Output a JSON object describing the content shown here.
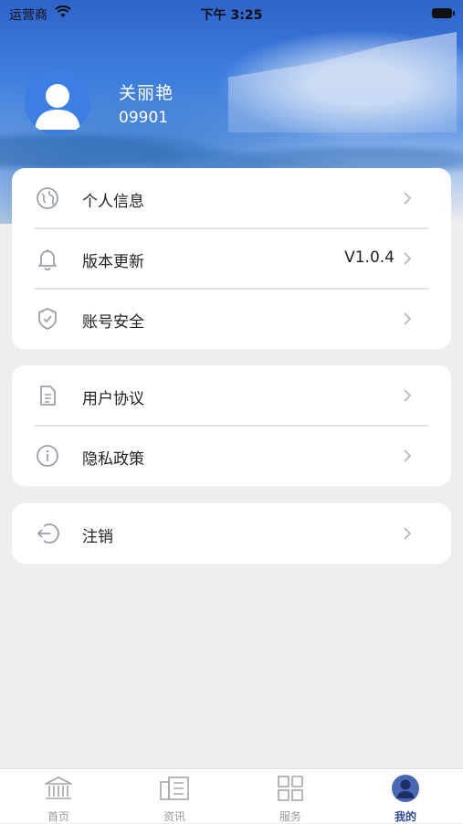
{
  "status_bar": {
    "carrier": "运营商",
    "time": "下午 3:25"
  },
  "profile": {
    "name": "关丽艳",
    "id": "09901"
  },
  "groups": [
    {
      "items": [
        {
          "label": "个人信息",
          "icon": "globe-icon"
        },
        {
          "label": "版本更新",
          "value": "V1.0.4",
          "icon": "bell-icon"
        },
        {
          "label": "账号安全",
          "icon": "shield-icon"
        }
      ]
    },
    {
      "items": [
        {
          "label": "用户协议",
          "icon": "document-icon"
        },
        {
          "label": "隐私政策",
          "icon": "info-icon"
        }
      ]
    },
    {
      "items": [
        {
          "label": "注销",
          "icon": "logout-icon"
        }
      ]
    }
  ],
  "tabs": [
    {
      "label": "首页",
      "icon": "home-icon"
    },
    {
      "label": "资讯",
      "icon": "news-icon"
    },
    {
      "label": "服务",
      "icon": "grid-icon"
    },
    {
      "label": "我的",
      "icon": "profile-icon",
      "active": true
    }
  ],
  "colors": {
    "accent": "#2f4a9a",
    "header_blue": "#3f7fe0",
    "icon_gray": "#9aa0aa"
  }
}
